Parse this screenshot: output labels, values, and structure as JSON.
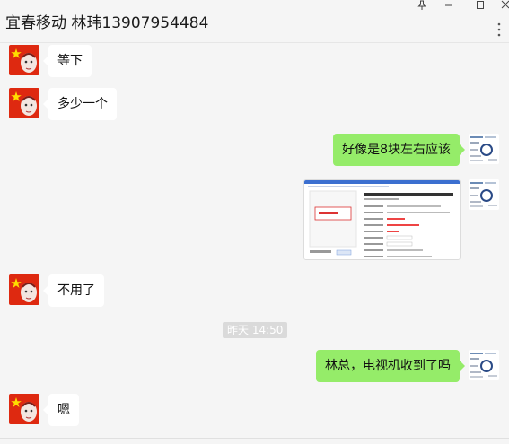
{
  "window": {
    "title": "宜春移动 林玮13907954484",
    "controls": {
      "pin_icon": "pin-icon",
      "minimize_icon": "minimize-icon",
      "maximize_icon": "maximize-icon",
      "close_icon": "close-icon",
      "more_icon": "more-icon"
    }
  },
  "messages": [
    {
      "side": "in",
      "text": "等下"
    },
    {
      "side": "in",
      "text": "多少一个"
    },
    {
      "side": "out",
      "text": "好像是8块左右应该"
    },
    {
      "side": "out",
      "type": "image",
      "image": "product-listing-screenshot"
    },
    {
      "side": "in",
      "text": "不用了"
    },
    {
      "type": "time",
      "text": "昨天 14:50"
    },
    {
      "side": "out",
      "text": "林总，电视机收到了吗"
    },
    {
      "side": "in",
      "text": "嗯"
    }
  ],
  "colors": {
    "bubble_out": "#95ec69",
    "bubble_in": "#ffffff",
    "background": "#f5f5f5",
    "flag_red": "#de2910",
    "flag_star": "#ffde00"
  }
}
